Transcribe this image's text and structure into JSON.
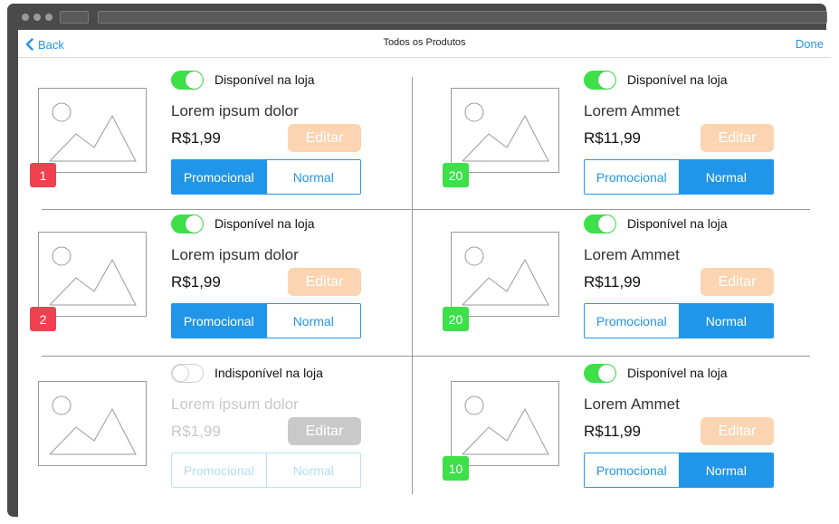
{
  "nav": {
    "back_label": "Back",
    "title": "Todos os Produtos",
    "done_label": "Done"
  },
  "colors": {
    "accent": "#2196e9",
    "toggle_on": "#3ee04a",
    "badge_red": "#f04150",
    "badge_green": "#3ee04a",
    "edit_enabled": "#fbd4b1",
    "edit_disabled": "#c9c9c9"
  },
  "products": [
    {
      "availability": "Disponível na loja",
      "available": true,
      "name": "Lorem ipsum dolor",
      "price": "R$1,99",
      "edit_label": "Editar",
      "badge": "1",
      "badge_color": "red",
      "seg_promo": "Promocional",
      "seg_normal": "Normal",
      "selected": "Promocional"
    },
    {
      "availability": "Disponível na loja",
      "available": true,
      "name": "Lorem Ammet",
      "price": "R$11,99",
      "edit_label": "Editar",
      "badge": "20",
      "badge_color": "green",
      "seg_promo": "Promocional",
      "seg_normal": "Normal",
      "selected": "Normal"
    },
    {
      "availability": "Disponível na loja",
      "available": true,
      "name": "Lorem ipsum dolor",
      "price": "R$1,99",
      "edit_label": "Editar",
      "badge": "2",
      "badge_color": "red",
      "seg_promo": "Promocional",
      "seg_normal": "Normal",
      "selected": "Promocional"
    },
    {
      "availability": "Disponível na loja",
      "available": true,
      "name": "Lorem Ammet",
      "price": "R$11,99",
      "edit_label": "Editar",
      "badge": "20",
      "badge_color": "green",
      "seg_promo": "Promocional",
      "seg_normal": "Normal",
      "selected": "Normal"
    },
    {
      "availability": "Indisponível na loja",
      "available": false,
      "name": "Lorem ipsum dolor",
      "price": "R$1,99",
      "edit_label": "Editar",
      "badge": "",
      "badge_color": "",
      "seg_promo": "Promocional",
      "seg_normal": "Normal",
      "selected": ""
    },
    {
      "availability": "Disponível na loja",
      "available": true,
      "name": "Lorem Ammet",
      "price": "R$11,99",
      "edit_label": "Editar",
      "badge": "10",
      "badge_color": "green",
      "seg_promo": "Promocional",
      "seg_normal": "Normal",
      "selected": "Normal"
    }
  ]
}
